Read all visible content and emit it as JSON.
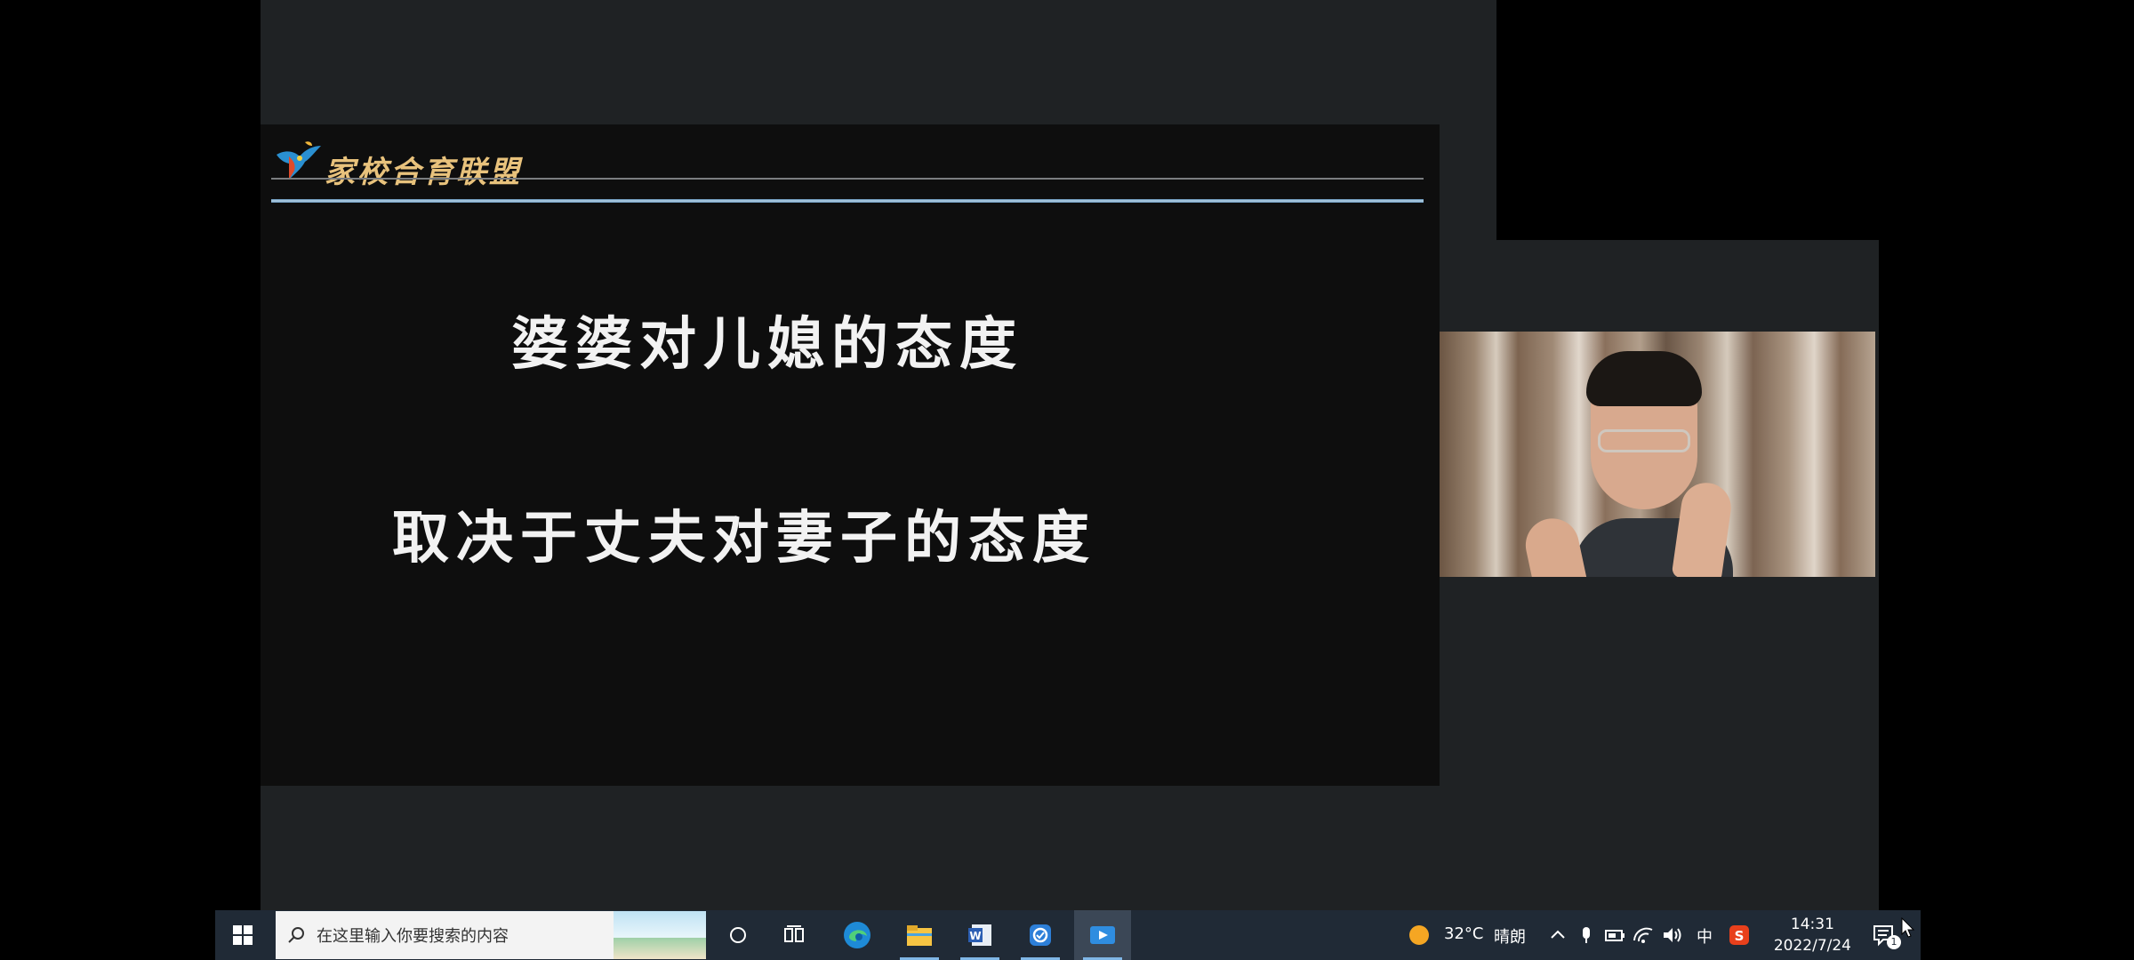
{
  "slide": {
    "brand": "家校合育联盟",
    "line1": "婆婆对儿媳的态度",
    "line2": "取决于丈夫对妻子的态度"
  },
  "taskbar": {
    "search_placeholder": "在这里输入你要搜索的内容",
    "icons": [
      "windows-start-icon",
      "search-icon",
      "cortana-icon",
      "task-view-icon",
      "edge-icon",
      "file-explorer-icon",
      "word-icon",
      "app-icon",
      "media-player-icon"
    ],
    "weather_temp": "32°C",
    "weather_desc": "晴朗",
    "ime": "中",
    "time": "14:31",
    "date": "2022/7/24",
    "notification_count": "1"
  },
  "colors": {
    "taskbar_bg": "#202a36",
    "share_bg": "#1f2224",
    "slide_bg": "#0e0e0e",
    "brand_color": "#e8c27c",
    "accent_line": "#b9d4e6"
  }
}
